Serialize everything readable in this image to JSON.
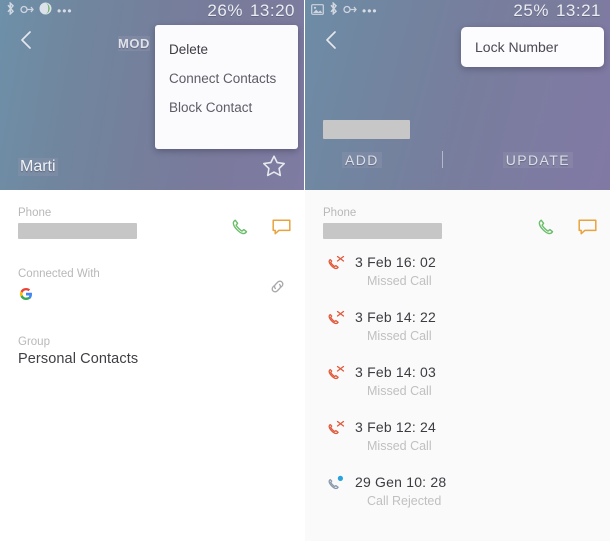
{
  "left": {
    "statusbar": {
      "icons": [
        "bluetooth-icon",
        "sync-icon",
        "leaf-icon",
        "more-dots-icon"
      ],
      "battery": "26%",
      "time": "13:20"
    },
    "header": {
      "back_icon": "back-chevron-icon",
      "mod_label": "MOD",
      "contact_name": "Marti",
      "favorite_icon": "star-icon"
    },
    "popup_menu": {
      "items": [
        {
          "label": "Delete"
        },
        {
          "label": "Connect Contacts"
        },
        {
          "label": "Block Contact"
        }
      ]
    },
    "details": [
      {
        "label": "Phone",
        "value_redacted": true,
        "actions": [
          "call-icon",
          "message-icon"
        ]
      },
      {
        "label": "Connected With",
        "account_icon": "google-icon",
        "actions": [
          "link-icon"
        ]
      },
      {
        "label": "Group",
        "value": "Personal Contacts"
      }
    ]
  },
  "right": {
    "statusbar": {
      "icons": [
        "image-icon",
        "bluetooth-icon",
        "sync-icon",
        "more-dots-icon"
      ],
      "battery": "25%",
      "time": "13:21"
    },
    "header": {
      "back_icon": "back-chevron-icon",
      "number_redacted": true,
      "add_label": "ADD",
      "update_label": "UPDATE"
    },
    "lock_popup": {
      "label": "Lock Number"
    },
    "details": [
      {
        "label": "Phone",
        "value_redacted": true,
        "actions": [
          "call-icon",
          "message-icon"
        ]
      }
    ],
    "call_log": [
      {
        "icon": "missed-call-icon",
        "time": "3 Feb 16: 02",
        "status": "Missed Call"
      },
      {
        "icon": "missed-call-icon",
        "time": "3 Feb 14: 22",
        "status": "Missed Call"
      },
      {
        "icon": "missed-call-icon",
        "time": "3 Feb 14: 03",
        "status": "Missed Call"
      },
      {
        "icon": "missed-call-icon",
        "time": "3 Feb 12: 24",
        "status": "Missed Call"
      },
      {
        "icon": "rejected-call-icon",
        "time": "29 Gen 10: 28",
        "status": "Call Rejected"
      }
    ]
  },
  "colors": {
    "missed_call": "#e05a3c",
    "rejected_call": "#29a3d9",
    "call_action": "#6bbd6b",
    "message_action": "#e8a33d",
    "header_blue": "#6e90a9",
    "header_purple": "#7f7ba2",
    "redaction": "#c6c6c6"
  }
}
